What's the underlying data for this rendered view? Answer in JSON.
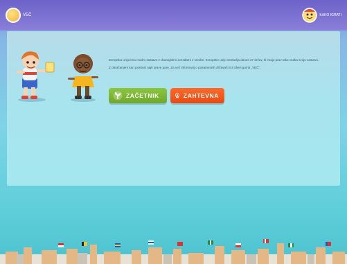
{
  "header": {
    "logo_label": "VEČ",
    "lang_label": "KAKO IGRATI"
  },
  "content": {
    "intro_paragraph": "Evropska unija ima modro zastavo z dvanajstimi zvezdami v sredini. Evropsko unijo sestavlja danes 27 držav, ki imajo prav tako vsaka svojo zastavo.",
    "instruction_paragraph": "Z obračanjem kart poskusi najti prave pare. Za več informacij o posameznih državah EU izberi gumb „VEČ“."
  },
  "buttons": {
    "beginner_label": "ZAČETNIK",
    "advanced_label": "ZAHTEVNA"
  },
  "colors": {
    "beginner": "#7cb637",
    "advanced": "#f25a1c",
    "topbar": "#7a70d2"
  },
  "icons": {
    "beginner_icon": "sprout-icon",
    "advanced_icon": "medal-icon",
    "logo_icon": "globe-character-icon",
    "lang_icon": "character-avatar-icon"
  }
}
